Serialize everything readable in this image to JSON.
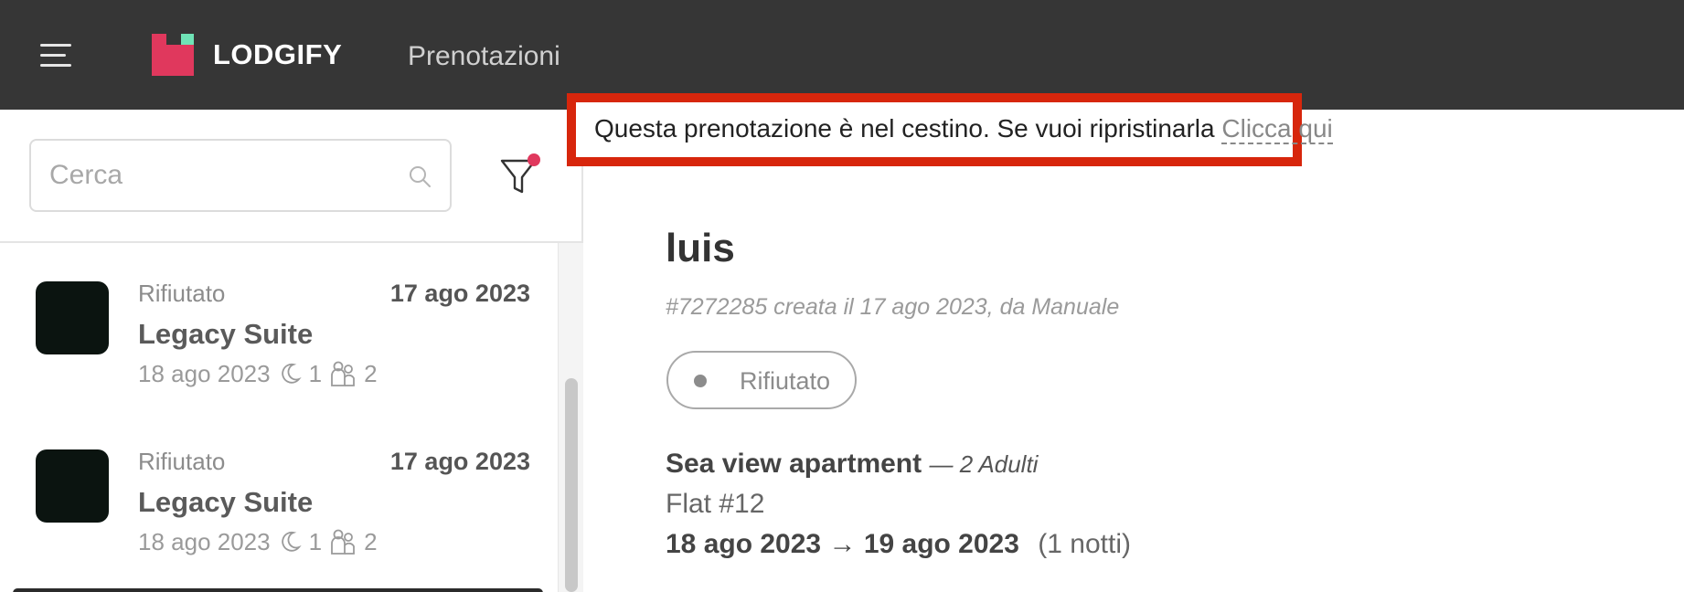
{
  "topbar": {
    "brand": "LODGIFY",
    "section": "Prenotazioni",
    "brand_colors": {
      "pink": "#e0385d",
      "mint": "#6fe3b6",
      "bar": "#363636"
    }
  },
  "search": {
    "placeholder": "Cerca",
    "value": ""
  },
  "filter": {
    "active_indicator_color": "#e0385d"
  },
  "list": {
    "items": [
      {
        "status": "Rifiutato",
        "created": "17 ago 2023",
        "property": "Legacy Suite",
        "checkin": "18 ago 2023",
        "nights": "1",
        "guests": "2"
      },
      {
        "status": "Rifiutato",
        "created": "17 ago 2023",
        "property": "Legacy Suite",
        "checkin": "18 ago 2023",
        "nights": "1",
        "guests": "2"
      }
    ]
  },
  "notice": {
    "text": "Questa prenotazione è nel cestino. Se vuoi ripristinarla",
    "link": "Clicca qui",
    "highlight_color": "#d7260c"
  },
  "detail": {
    "guest_name": "luis",
    "meta": "#7272285 creata il 17 ago 2023, da Manuale",
    "status": "Rifiutato",
    "property": "Sea view apartment",
    "guests_text": "— 2 Adulti",
    "unit": "Flat #12",
    "checkin": "18 ago 2023",
    "arrow": "→",
    "checkout": "19 ago 2023",
    "nights_text": "(1 notti)"
  }
}
